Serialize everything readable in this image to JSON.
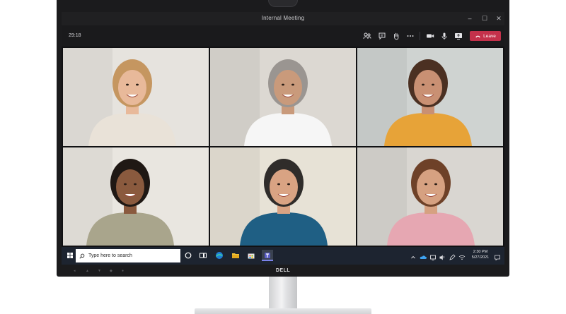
{
  "window": {
    "title": "Internal Meeting",
    "controls": {
      "minimize": "–",
      "maximize": "☐",
      "close": "✕"
    }
  },
  "toolbar": {
    "timer": "29:18",
    "icons": [
      "participants-icon",
      "chat-icon",
      "raise-hand-icon",
      "more-options-icon",
      "camera-icon",
      "microphone-icon",
      "share-screen-icon"
    ],
    "leave_label": "Leave",
    "leave_color": "#c4314b"
  },
  "participants": [
    {
      "shirt": "#e9e2d8",
      "skin": "#e8b99a",
      "hair": "#c59660",
      "bg": "#e6e3de"
    },
    {
      "shirt": "#f6f6f6",
      "skin": "#c99a7b",
      "hair": "#9a9591",
      "bg": "#dcd8d2"
    },
    {
      "shirt": "#e7a338",
      "skin": "#c99073",
      "hair": "#4b3022",
      "bg": "#cfd3d1"
    },
    {
      "shirt": "#a9a58c",
      "skin": "#8a5a3e",
      "hair": "#1f1814",
      "bg": "#e9e6e0"
    },
    {
      "shirt": "#1f5f84",
      "skin": "#d9a383",
      "hair": "#2f2c2a",
      "bg": "#e7e2d6"
    },
    {
      "shirt": "#e6a7b2",
      "skin": "#d6a181",
      "hair": "#6e4128",
      "bg": "#d9d6d1"
    }
  ],
  "taskbar": {
    "search_placeholder": "Type here to search",
    "apps": [
      "cortana-icon",
      "task-view-icon",
      "edge-icon",
      "file-explorer-icon",
      "store-icon",
      "teams-icon"
    ],
    "tray": [
      "chevron-up-icon",
      "onedrive-icon",
      "network-icon",
      "volume-icon",
      "pen-icon",
      "wifi-icon"
    ],
    "time": "2:30 PM",
    "date": "5/27/2021"
  },
  "monitor": {
    "brand": "DELL",
    "osd_buttons": [
      "◂",
      "▲",
      "▼",
      "◆",
      "●"
    ]
  }
}
